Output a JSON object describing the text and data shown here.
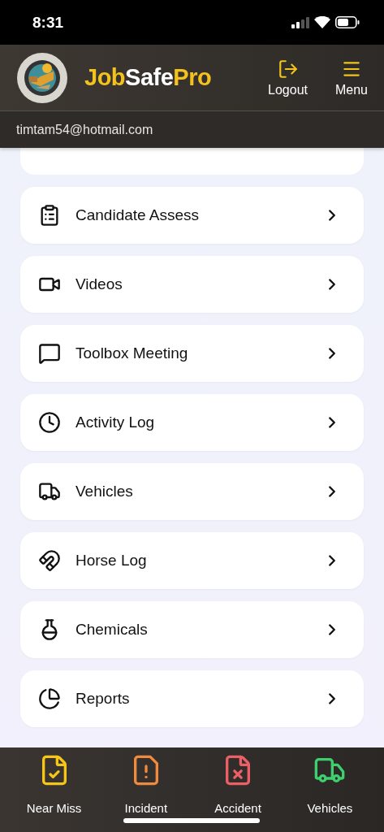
{
  "status_bar": {
    "time": "8:31"
  },
  "header": {
    "title_parts": [
      "Job",
      "Safe",
      "Pro"
    ],
    "actions": [
      {
        "kind": "logout",
        "label": "Logout"
      },
      {
        "kind": "menu",
        "label": "Menu"
      }
    ]
  },
  "user_email": "timtam54@hotmail.com",
  "menu_items": [
    {
      "kind": "clipboard",
      "label": "Candidate Assess"
    },
    {
      "kind": "video",
      "label": "Videos"
    },
    {
      "kind": "chat",
      "label": "Toolbox Meeting"
    },
    {
      "kind": "clock",
      "label": "Activity Log"
    },
    {
      "kind": "truck",
      "label": "Vehicles"
    },
    {
      "kind": "magnet",
      "label": "Horse Log"
    },
    {
      "kind": "flask",
      "label": "Chemicals"
    },
    {
      "kind": "pie",
      "label": "Reports"
    }
  ],
  "bottom_nav": [
    {
      "kind": "file-check",
      "label": "Near Miss",
      "color": "#f5c518"
    },
    {
      "kind": "file-alert",
      "label": "Incident",
      "color": "#f08a3c"
    },
    {
      "kind": "file-x",
      "label": "Accident",
      "color": "#ec5f67"
    },
    {
      "kind": "truck",
      "label": "Vehicles",
      "color": "#3ecf6e"
    }
  ]
}
